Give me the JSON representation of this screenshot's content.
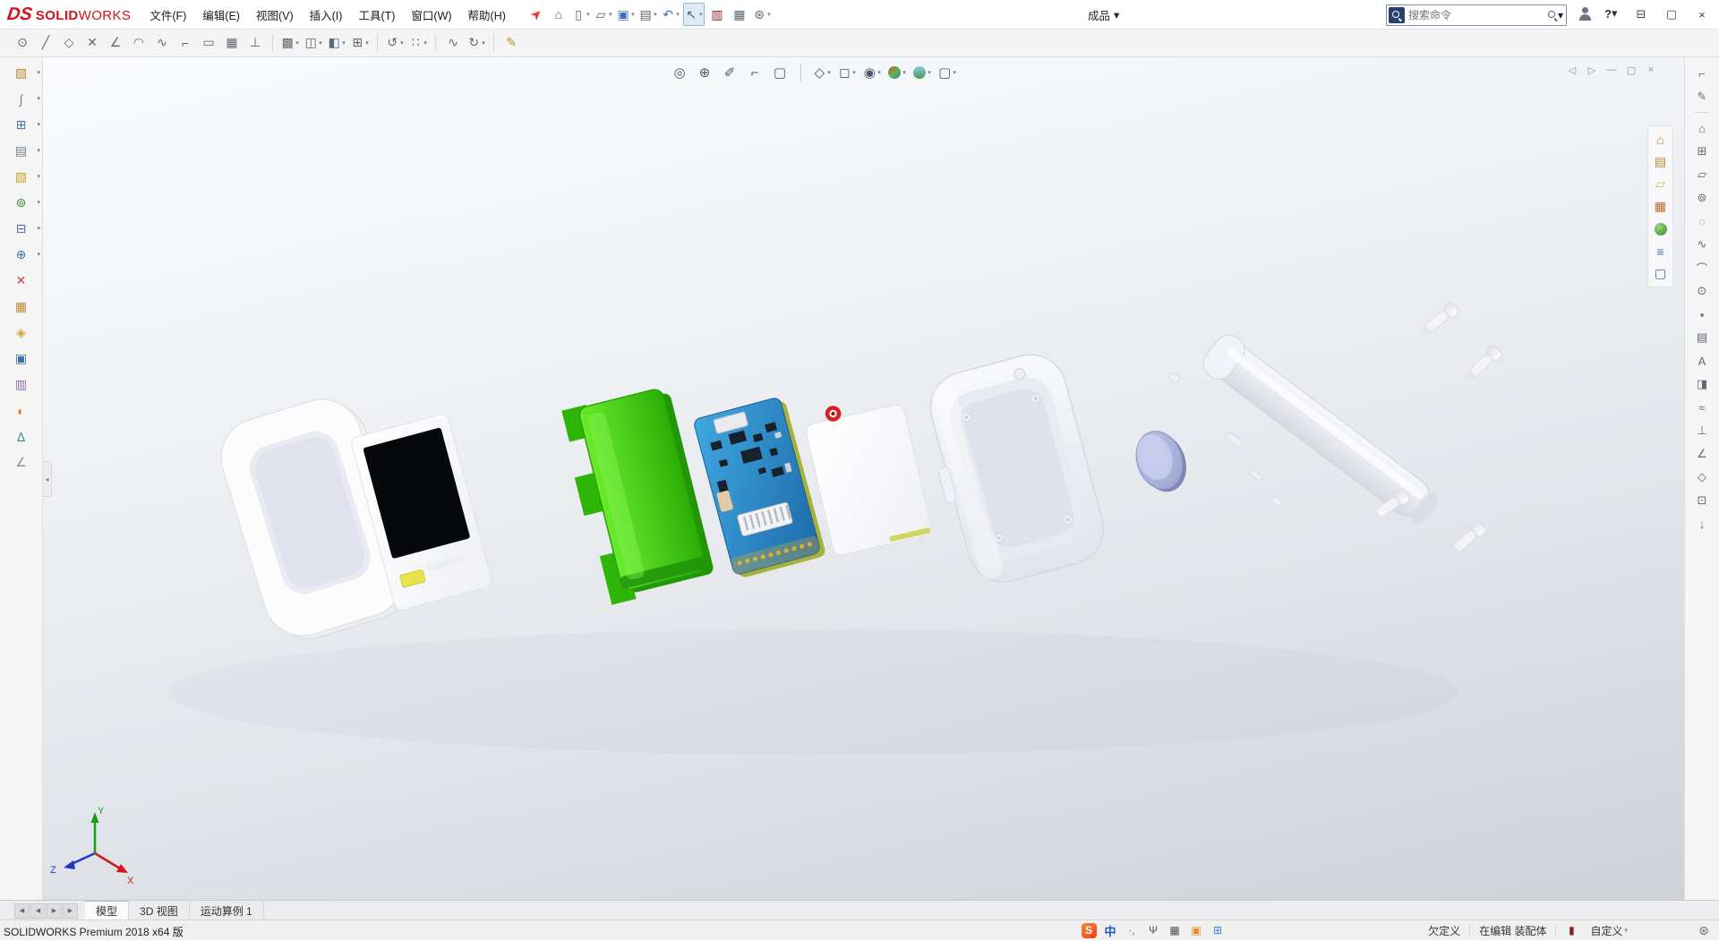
{
  "brand": {
    "ds": "DS",
    "solid": "SOLID",
    "works": "WORKS",
    "red": "#d6121c"
  },
  "doc": {
    "title": "成品"
  },
  "search": {
    "placeholder": "搜索命令"
  },
  "help": {
    "label": "?"
  },
  "menubar": {
    "items": [
      {
        "t": "文件(F)",
        "name": "menu-file"
      },
      {
        "t": "编辑(E)",
        "name": "menu-edit"
      },
      {
        "t": "视图(V)",
        "name": "menu-view"
      },
      {
        "t": "插入(I)",
        "name": "menu-insert"
      },
      {
        "t": "工具(T)",
        "name": "menu-tools"
      },
      {
        "t": "窗口(W)",
        "name": "menu-window"
      },
      {
        "t": "帮助(H)",
        "name": "menu-help"
      }
    ]
  },
  "top_toolbar": {
    "items": [
      {
        "g": "➤",
        "name": "welcome-rocket-icon",
        "cls": "rocket",
        "color": "#e43b2c"
      },
      {
        "g": "⌂",
        "name": "home-icon"
      },
      {
        "g": "▯",
        "name": "new-document-icon",
        "drop": true
      },
      {
        "g": "▱",
        "name": "open-document-icon",
        "drop": true
      },
      {
        "g": "▣",
        "name": "save-icon",
        "color": "#3f6fb5",
        "drop": true
      },
      {
        "g": "▤",
        "name": "print-icon",
        "drop": true
      },
      {
        "g": "↶",
        "name": "undo-icon",
        "color": "#2f6fc0",
        "drop": true
      },
      {
        "g": "↖",
        "name": "select-icon",
        "cls": "pressed",
        "drop": true
      },
      {
        "g": "▥",
        "name": "selection-filter-icon",
        "color": "#8a2020"
      },
      {
        "g": "▦",
        "name": "display-settings-icon"
      },
      {
        "g": "⊛",
        "name": "options-icon",
        "drop": true
      }
    ]
  },
  "window_controls": {
    "items": [
      {
        "g": "⊟",
        "name": "window-minimize-icon"
      },
      {
        "g": "▢",
        "name": "window-restore-icon"
      },
      {
        "g": "×",
        "name": "window-close-icon"
      }
    ]
  },
  "toolbar2": {
    "items": [
      {
        "g": "⊙",
        "name": "circle-tool-icon"
      },
      {
        "g": "╱",
        "name": "line-tool-icon"
      },
      {
        "g": "◇",
        "name": "polygon-tool-icon"
      },
      {
        "g": "✕",
        "name": "trim-entities-icon"
      },
      {
        "g": "∠",
        "name": "smart-dimension-icon"
      },
      {
        "g": "◠",
        "name": "arc-tool-icon"
      },
      {
        "g": "∿",
        "name": "spline-tool-icon"
      },
      {
        "g": "⌐",
        "name": "corner-rectangle-icon"
      },
      {
        "g": "▭",
        "name": "center-rectangle-icon"
      },
      {
        "g": "▦",
        "name": "sketch-grid-icon"
      },
      {
        "g": "⊥",
        "name": "perpendicular-icon"
      },
      {
        "sep": true
      },
      {
        "g": "▩",
        "name": "convert-entities-icon",
        "drop": true
      },
      {
        "g": "◫",
        "name": "mirror-entities-icon",
        "drop": true
      },
      {
        "g": "◧",
        "name": "offset-entities-icon",
        "drop": true
      },
      {
        "g": "⊞",
        "name": "linear-sketch-pattern-icon",
        "drop": true
      },
      {
        "sep": true
      },
      {
        "g": "↺",
        "name": "rotate-entities-icon",
        "drop": true
      },
      {
        "g": "∷",
        "name": "sketch-relations-icon",
        "drop": true
      },
      {
        "sep": true
      },
      {
        "g": "∿",
        "name": "style-spline-icon"
      },
      {
        "g": "↻",
        "name": "redo-icon",
        "drop": true
      },
      {
        "sep": true
      },
      {
        "g": "✎",
        "name": "sketch-icon",
        "color": "#b8912e"
      }
    ]
  },
  "left_toolbar": {
    "items": [
      {
        "g": "▧",
        "name": "features-icon",
        "color": "#c98a2e",
        "drop": true
      },
      {
        "g": "∫",
        "name": "attachment-icon",
        "color": "#7a8694",
        "drop": true
      },
      {
        "g": "⊞",
        "name": "pattern-icon",
        "color": "#4a6fae",
        "drop": true
      },
      {
        "g": "▤",
        "name": "bom-table-icon",
        "color": "#77828e",
        "drop": true
      },
      {
        "g": "▨",
        "name": "appearance-icon",
        "color": "#c9a22e",
        "drop": true
      },
      {
        "g": "⊚",
        "name": "motion-icon",
        "color": "#3a8a3a",
        "drop": true
      },
      {
        "g": "⊟",
        "name": "section-tool-icon",
        "color": "#4a6fae",
        "drop": true
      },
      {
        "g": "⊕",
        "name": "mate-icon",
        "color": "#4a6fae",
        "drop": true
      },
      {
        "g": "✕",
        "name": "delete-icon",
        "color": "#b05050"
      },
      {
        "g": "▦",
        "name": "design-table-icon",
        "color": "#c98a2e"
      },
      {
        "g": "◈",
        "name": "feature-manager-icon",
        "color": "#d8a23a"
      },
      {
        "g": "▣",
        "name": "block-icon",
        "color": "#3a6fae"
      },
      {
        "g": "▥",
        "name": "library-icon",
        "color": "#8a6fae"
      },
      {
        "g": "◐",
        "name": "render-icon",
        "color": "#d8742e"
      },
      {
        "g": "∆",
        "name": "measure-icon",
        "color": "#3a8a8a"
      },
      {
        "g": "∠",
        "name": "dimension-icon",
        "color": "#808a94"
      }
    ]
  },
  "heads_up": {
    "items": [
      {
        "g": "◎",
        "name": "zoom-fit-icon"
      },
      {
        "g": "⊕",
        "name": "zoom-to-area-icon"
      },
      {
        "g": "✐",
        "name": "previous-view-icon"
      },
      {
        "g": "⌐",
        "name": "section-view-icon"
      },
      {
        "g": "▢",
        "name": "dynamic-annotation-icon"
      },
      {
        "sep": true
      },
      {
        "g": "◇",
        "name": "view-orientation-icon",
        "drop": true
      },
      {
        "g": "◻",
        "name": "display-style-icon",
        "drop": true
      },
      {
        "g": "◉",
        "name": "hide-show-items-icon",
        "drop": true
      },
      {
        "g": "",
        "name": "edit-appearance-icon",
        "cls": "ball",
        "bg": "linear-gradient(135deg,#e05252 0%,#58b847 55%,#3a6fd8 100%)",
        "drop": true
      },
      {
        "g": "",
        "name": "apply-scene-icon",
        "cls": "ball",
        "bg": "linear-gradient(180deg,#8ec9ec,#4a9a4a)",
        "drop": true
      },
      {
        "g": "▢",
        "name": "view-settings-icon",
        "drop": true
      }
    ]
  },
  "doc_controls": {
    "items": [
      {
        "g": "◁",
        "name": "previous-window-icon"
      },
      {
        "g": "▷",
        "name": "next-window-icon"
      },
      {
        "g": "—",
        "name": "minimize-document-icon"
      },
      {
        "g": "▢",
        "name": "restore-document-icon"
      },
      {
        "g": "×",
        "name": "close-document-icon"
      }
    ]
  },
  "task_pane": {
    "items": [
      {
        "g": "⌂",
        "name": "solidworks-resources-icon",
        "color": "#c9762e"
      },
      {
        "g": "▤",
        "name": "design-library-icon",
        "color": "#b08a3a"
      },
      {
        "g": "▱",
        "name": "file-explorer-icon",
        "color": "#d8b23a"
      },
      {
        "g": "▦",
        "name": "view-palette-icon",
        "color": "#c96a2e"
      },
      {
        "g": "",
        "name": "appearances-scenes-icon",
        "cls": "ball",
        "bg": "radial-gradient(circle at 35% 30%,#9fd87a,#2e8a3a)"
      },
      {
        "g": "≡",
        "name": "custom-properties-icon",
        "color": "#3a6fae"
      },
      {
        "g": "▢",
        "name": "forum-icon",
        "color": "#3a6fae"
      }
    ]
  },
  "right_strip": {
    "items": [
      {
        "g": "⌐",
        "name": "pin-taskpane-icon"
      },
      {
        "g": "✎",
        "name": "markup-icon"
      },
      {
        "sep": true
      },
      {
        "g": "⌂",
        "name": "view-home-icon"
      },
      {
        "g": "⊞",
        "name": "tile-windows-icon"
      },
      {
        "g": "▱",
        "name": "file-explorer-icon"
      },
      {
        "g": "⊚",
        "name": "target-icon"
      },
      {
        "g": "◌",
        "name": "reference-circle-icon"
      },
      {
        "g": "∿",
        "name": "curve-icon"
      },
      {
        "g": "⌒",
        "name": "arc-icon"
      },
      {
        "g": "⊙",
        "name": "point-icon"
      },
      {
        "g": "▪",
        "name": "solid-dot-icon"
      },
      {
        "g": "▤",
        "name": "list-icon"
      },
      {
        "t": "A",
        "name": "annotation-text-icon"
      },
      {
        "g": "◨",
        "name": "pane-right-icon"
      },
      {
        "g": "≈",
        "name": "surface-icon"
      },
      {
        "g": "⊥",
        "name": "normal-to-icon"
      },
      {
        "g": "∠",
        "name": "angle-measure-icon"
      },
      {
        "g": "◇",
        "name": "diamond-icon"
      },
      {
        "g": "⊡",
        "name": "boxed-point-icon"
      },
      {
        "g": "↓",
        "name": "down-arrow-icon"
      }
    ]
  },
  "viewport": {
    "triad": {
      "x": "X",
      "y": "Y",
      "z": "Z"
    },
    "colors": {
      "screen": "#07080a",
      "green": "#3bd411",
      "pcb": "#2e8fd0",
      "red_ring": "#da1f1f",
      "battery": "#a6b0d8",
      "case": "#eef0f6",
      "cylinder": "#e9eaf2",
      "screw": "#f4f4f8",
      "select_accent": "#2a6fc0"
    }
  },
  "tabs": {
    "nav": [
      {
        "g": "◀",
        "name": "tab-scroll-left-end-icon"
      },
      {
        "g": "◀",
        "name": "tab-scroll-left-icon"
      },
      {
        "g": "▶",
        "name": "tab-scroll-right-icon"
      },
      {
        "g": "▶",
        "name": "tab-scroll-right-end-icon"
      }
    ],
    "items": [
      {
        "t": "模型",
        "name": "tab-model",
        "cls": "active"
      },
      {
        "t": "3D 视图",
        "name": "tab-3d-views"
      },
      {
        "t": "运动算例 1",
        "name": "tab-motion-study-1"
      }
    ]
  },
  "status": {
    "left": "SOLIDWORKS Premium 2018 x64 版",
    "ime": [
      {
        "t": "S",
        "name": "sogou-input-icon",
        "cls": "sogou",
        "bg": "linear-gradient(135deg,#fb8a2e,#e8401c)",
        "color": "#fff"
      },
      {
        "t": "中",
        "name": "ime-chinese-mode",
        "cls": "imetext",
        "color": "#1a56c4"
      },
      {
        "t": "·,",
        "name": "ime-punctuation-icon",
        "cls": "imesmall"
      },
      {
        "t": "Ψ",
        "name": "ime-mic-icon",
        "cls": "imesmall"
      },
      {
        "g": "▦",
        "name": "ime-keyboard-icon",
        "cls": "imesmall"
      },
      {
        "g": "▣",
        "name": "ime-toolbox-icon",
        "color": "#f08a1e"
      },
      {
        "g": "⊞",
        "name": "ime-grid-icon",
        "color": "#4a7fd8"
      }
    ],
    "right": [
      {
        "t": "欠定义",
        "name": "status-under-defined",
        "cls": "stext",
        "inter": false
      },
      {
        "sep": true
      },
      {
        "t": "在编辑 装配体",
        "name": "status-editing-assembly",
        "cls": "stext",
        "inter": false
      },
      {
        "sep": true
      },
      {
        "g": "▮",
        "name": "status-battery-icon",
        "color": "#8a2020",
        "inter": false
      },
      {
        "t": "自定义",
        "name": "status-customize",
        "cls": "stext",
        "drop": true
      }
    ],
    "corner": [
      {
        "g": "⊛",
        "name": "status-settings-icon",
        "color": "#5a7a64"
      }
    ]
  }
}
